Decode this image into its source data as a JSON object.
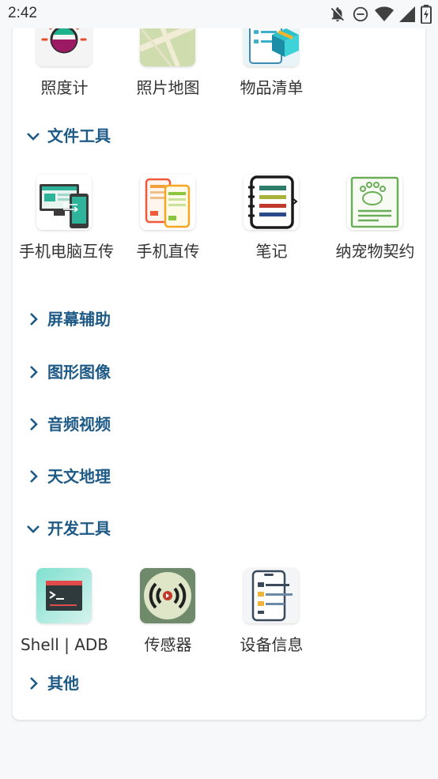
{
  "status_bar": {
    "time": "2:42",
    "icons": [
      "notifications-off-icon",
      "do-not-disturb-icon",
      "wifi-icon",
      "signal-icon",
      "battery-charging-icon"
    ]
  },
  "colors": {
    "section_title": "#1e5a86",
    "chevron": "#1e5a86",
    "card_bg": "#ffffff",
    "page_bg": "#f7f8fa"
  },
  "top_tiles": [
    {
      "label": "照度计",
      "icon": "light-meter-icon"
    },
    {
      "label": "照片地图",
      "icon": "photo-map-icon"
    },
    {
      "label": "物品清单",
      "icon": "item-list-icon"
    }
  ],
  "sections": {
    "file_tools": {
      "title": "文件工具",
      "expanded": true,
      "tiles": [
        {
          "label": "手机电脑互传",
          "icon": "phone-pc-transfer-icon"
        },
        {
          "label": "手机直传",
          "icon": "phone-direct-transfer-icon"
        },
        {
          "label": "笔记",
          "icon": "notes-icon"
        },
        {
          "label": "纳宠物契约",
          "icon": "pet-contract-icon"
        }
      ]
    },
    "screen_assist": {
      "title": "屏幕辅助",
      "expanded": false
    },
    "graphics_image": {
      "title": "图形图像",
      "expanded": false
    },
    "audio_video": {
      "title": "音频视频",
      "expanded": false
    },
    "astronomy_geo": {
      "title": "天文地理",
      "expanded": false
    },
    "dev_tools": {
      "title": "开发工具",
      "expanded": true,
      "tiles": [
        {
          "label": "Shell | ADB",
          "icon": "terminal-icon"
        },
        {
          "label": "传感器",
          "icon": "sensor-icon"
        },
        {
          "label": "设备信息",
          "icon": "device-info-icon"
        }
      ]
    },
    "other": {
      "title": "其他",
      "expanded": false
    }
  }
}
